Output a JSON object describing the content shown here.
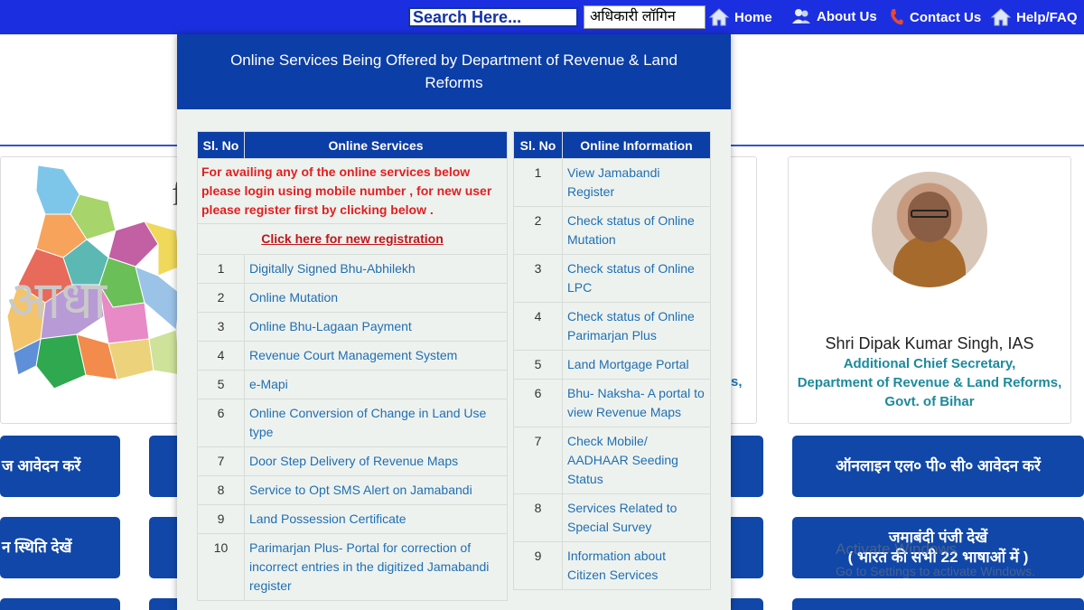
{
  "topbar": {
    "search_label": "Search Here...",
    "login_label": "अधिकारी लॉगिन",
    "nav": [
      {
        "label": "Home",
        "icon": "home-icon"
      },
      {
        "label": "About Us",
        "icon": "users-icon"
      },
      {
        "label": "Contact Us",
        "icon": "phone-icon"
      },
      {
        "label": "Help/FAQ",
        "icon": "home-icon"
      }
    ]
  },
  "popup": {
    "title": "Online Services Being Offered by Department of Revenue & Land Reforms",
    "services": {
      "col_no": "Sl. No",
      "col_name": "Online Services",
      "notice": "For availing any of the online services below please login using mobile number , for new user please register first by clicking below .",
      "register_link": "Click here for new registration",
      "rows": [
        {
          "no": "1",
          "name": "Digitally Signed Bhu-Abhilekh"
        },
        {
          "no": "2",
          "name": "Online Mutation"
        },
        {
          "no": "3",
          "name": "Online Bhu-Lagaan Payment"
        },
        {
          "no": "4",
          "name": "Revenue Court Management System"
        },
        {
          "no": "5",
          "name": "e-Mapi"
        },
        {
          "no": "6",
          "name": "Online Conversion of Change in Land Use type"
        },
        {
          "no": "7",
          "name": "Door Step Delivery of Revenue Maps"
        },
        {
          "no": "8",
          "name": "Service to Opt SMS Alert on Jamabandi"
        },
        {
          "no": "9",
          "name": "Land Possession Certificate"
        },
        {
          "no": "10",
          "name": "Parimarjan Plus- Portal for correction of incorrect entries in the digitized Jamabandi register"
        }
      ]
    },
    "information": {
      "col_no": "Sl. No",
      "col_name": "Online Information",
      "rows": [
        {
          "no": "1",
          "name": "View Jamabandi Register"
        },
        {
          "no": "2",
          "name": "Check status of Online Mutation"
        },
        {
          "no": "3",
          "name": "Check status of Online LPC"
        },
        {
          "no": "4",
          "name": "Check status of Online Parimarjan Plus"
        },
        {
          "no": "5",
          "name": "Land Mortgage Portal"
        },
        {
          "no": "6",
          "name": "Bhu- Naksha- A portal to view Revenue Maps"
        },
        {
          "no": "7",
          "name": "Check Mobile/ AADHAAR Seeding Status"
        },
        {
          "no": "8",
          "name": "Services Related to Special Survey"
        },
        {
          "no": "9",
          "name": "Information about Citizen Services"
        }
      ]
    }
  },
  "background": {
    "map_overlay_text": "आधा",
    "partial_letter": "f",
    "mid_partial_text": "s,",
    "profile": {
      "name": "Shri Dipak Kumar Singh, IAS",
      "role_line1": "Additional Chief Secretary,",
      "role_line2": "Department of Revenue & Land Reforms,",
      "role_line3": "Govt. of Bihar"
    },
    "buttons": {
      "left1": "ज आवेदन करें",
      "left2": "न स्थिति देखें",
      "right1": "ऑनलाइन एल० पी० सी० आवेदन करें",
      "right2_line1": "जमाबंदी पंजी देखें",
      "right2_line2": "( भारत की सभी 22 भाषाओं में )"
    },
    "watermark_line1": "Activate Windows",
    "watermark_line2": "Go to Settings to activate Windows."
  },
  "colors": {
    "topbar": "#1b2fe0",
    "header_blue": "#0b3ea6",
    "link_blue": "#1f6fb2",
    "notice_red": "#e01f1f",
    "teal": "#1c8a9c"
  }
}
